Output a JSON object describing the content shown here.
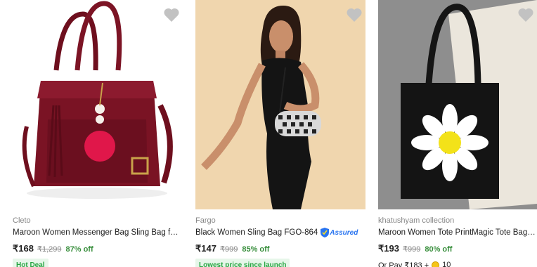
{
  "products": [
    {
      "brand": "Cleto",
      "title": "Maroon Women Messenger Bag Sling Bag for...",
      "price": "₹168",
      "mrp": "₹1,299",
      "discount": "87% off",
      "tag": "Hot Deal",
      "image_icon": "maroon-handbag-image"
    },
    {
      "brand": "Fargo",
      "title": "Black Women Sling Bag FGO-864",
      "assured": "Assured",
      "price": "₹147",
      "mrp": "₹999",
      "discount": "85% off",
      "tag": "Lowest price since launch",
      "image_icon": "model-with-sling-bag-image"
    },
    {
      "brand": "khatushyam collection",
      "title": "Maroon Women Tote PrintMagic Tote Bag for ...",
      "price": "₹193",
      "mrp": "₹999",
      "discount": "80% off",
      "pay_prefix": "Or Pay ₹183 +",
      "pay_coins": "10",
      "image_icon": "tote-bag-daisy-image"
    }
  ],
  "colors": {
    "discount_green": "#388e3c",
    "tag_bg": "#e6f6e9",
    "assured_blue": "#2874f0",
    "wishlist_heart": "#c2c2c2"
  }
}
